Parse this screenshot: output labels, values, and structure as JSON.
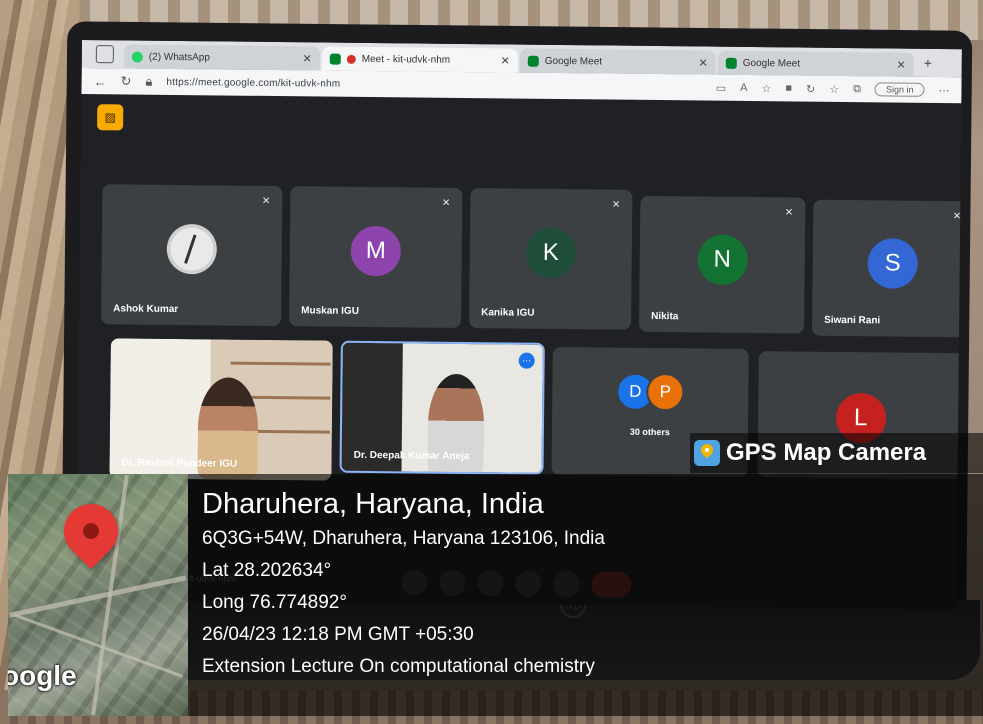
{
  "browser": {
    "tabs": [
      {
        "label": "(2) WhatsApp",
        "active": false
      },
      {
        "label": "Meet - kit-udvk-nhm",
        "active": true
      },
      {
        "label": "Google Meet",
        "active": false
      },
      {
        "label": "Google Meet",
        "active": false
      }
    ],
    "url": "https://meet.google.com/kit-udvk-nhm",
    "sign_in_label": "Sign in"
  },
  "meet": {
    "meeting_code": "kit-udvk-nhm",
    "top_row": [
      {
        "name": "Ashok Kumar",
        "initial": "",
        "color": "#dcdcdc"
      },
      {
        "name": "Muskan IGU",
        "initial": "M",
        "color": "#8e44ad"
      },
      {
        "name": "Kanika IGU",
        "initial": "K",
        "color": "#1e4d3a"
      },
      {
        "name": "Nikita",
        "initial": "N",
        "color": "#137333"
      },
      {
        "name": "Siwani Rani",
        "initial": "S",
        "color": "#3367d6"
      }
    ],
    "bottom_row": [
      {
        "name": "Dr. Rashmi Pundeer IGU"
      },
      {
        "name": "Dr. Deepak Kumar Aneja"
      },
      {
        "name": "30 others",
        "initials": [
          "D",
          "P"
        ],
        "colors": [
          "#1a73e8",
          "#e8710a"
        ]
      },
      {
        "name": "",
        "initial": "L",
        "color": "#c5221f"
      }
    ]
  },
  "gps": {
    "app_name": "GPS Map Camera",
    "place": "Dharuhera, Haryana, India",
    "address": "6Q3G+54W, Dharuhera, Haryana 123106, India",
    "lat": "Lat 28.202634°",
    "long": "Long 76.774892°",
    "datetime": "26/04/23 12:18 PM GMT +05:30",
    "note": "Extension Lecture On computational chemistry",
    "map_brand": "oogle"
  }
}
